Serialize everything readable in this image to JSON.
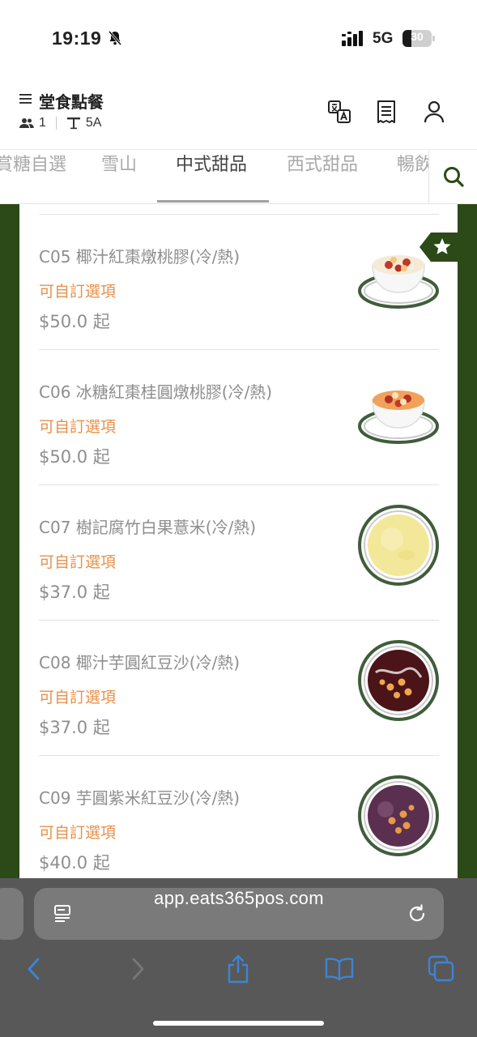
{
  "status_bar": {
    "time": "19:19",
    "network": "5G",
    "battery_level": 30,
    "battery_text": "30"
  },
  "header": {
    "title": "堂食點餐",
    "guests": "1",
    "table": "5A",
    "icons": [
      "menu-icon",
      "translate-icon",
      "receipt-icon",
      "user-icon"
    ]
  },
  "tabs": {
    "items": [
      {
        "label": "賞糖自選"
      },
      {
        "label": "雪山"
      },
      {
        "label": "中式甜品",
        "active": true
      },
      {
        "label": "西式甜品"
      },
      {
        "label": "暢飲"
      }
    ]
  },
  "menu_items": [
    {
      "name": "C05 椰汁紅棗燉桃膠(冷/熱)",
      "option": "可自訂選項",
      "price": "$50.0 起",
      "icon": "stewed-dessert-bowl",
      "favorite": true
    },
    {
      "name": "C06 冰糖紅棗桂圓燉桃膠(冷/熱)",
      "option": "可自訂選項",
      "price": "$50.0 起",
      "icon": "stewed-dessert-bowl"
    },
    {
      "name": "C07 樹記腐竹白果薏米(冷/熱)",
      "option": "可自訂選項",
      "price": "$37.0 起",
      "icon": "yellow-soup-plate"
    },
    {
      "name": "C08 椰汁芋圓紅豆沙(冷/熱)",
      "option": "可自訂選項",
      "price": "$37.0 起",
      "icon": "red-bean-soup-plate"
    },
    {
      "name": "C09 芋圓紫米紅豆沙(冷/熱)",
      "option": "可自訂選項",
      "price": "$40.0 起",
      "icon": "purple-rice-soup-plate"
    }
  ],
  "browser": {
    "url": "app.eats365pos.com"
  },
  "colors": {
    "accent_green": "#2b4a17",
    "option_orange": "#e8914a",
    "toolbar_blue": "#3d84d6"
  }
}
